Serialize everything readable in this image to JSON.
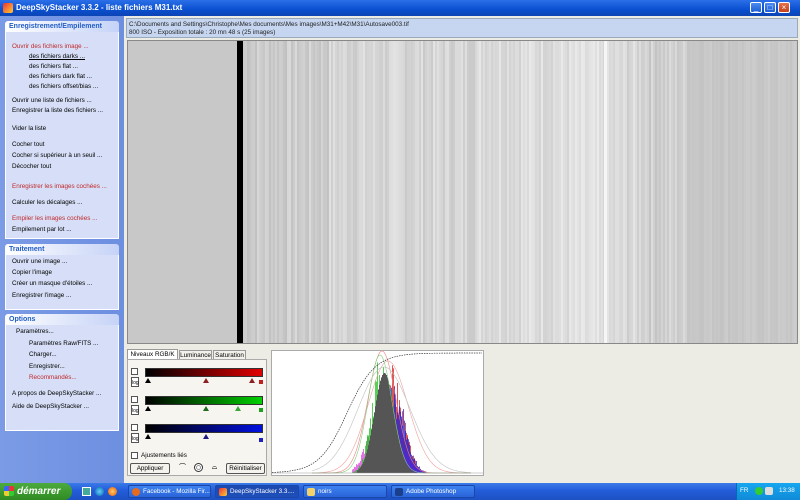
{
  "window": {
    "title": "DeepSkyStacker 3.3.2 - liste fichiers M31.txt"
  },
  "sidebar": {
    "sections": [
      {
        "title": "Enregistrement/Empilement",
        "items": [
          {
            "label": "Ouvrir des fichiers image ...",
            "style": "red",
            "indent": 0
          },
          {
            "label": "des fichiers darks ...",
            "style": "underline",
            "indent": 1
          },
          {
            "label": "des fichiers flat ...",
            "style": "normal",
            "indent": 1
          },
          {
            "label": "des fichiers dark flat ...",
            "style": "normal",
            "indent": 1
          },
          {
            "label": "des fichiers offset/bias ...",
            "style": "normal",
            "indent": 1
          },
          {
            "label": "Ouvrir une liste de fichiers ...",
            "style": "normal",
            "indent": 0
          },
          {
            "label": "Enregistrer la liste des fichiers ...",
            "style": "normal",
            "indent": 0
          },
          {
            "label": "Vider la liste",
            "style": "normal",
            "indent": 0
          },
          {
            "label": "Cocher tout",
            "style": "normal",
            "indent": 0
          },
          {
            "label": "Cocher si supérieur à un seuil ...",
            "style": "normal",
            "indent": 0
          },
          {
            "label": "Décocher tout",
            "style": "normal",
            "indent": 0
          },
          {
            "label": "Enregistrer les images cochées ...",
            "style": "red",
            "indent": 0
          },
          {
            "label": "Calculer les décalages ...",
            "style": "normal",
            "indent": 0
          },
          {
            "label": "Empiler les images cochées ...",
            "style": "red",
            "indent": 0
          },
          {
            "label": "Empilement par lot ...",
            "style": "normal",
            "indent": 0
          }
        ]
      },
      {
        "title": "Traitement",
        "items": [
          {
            "label": "Ouvrir une image ...",
            "style": "normal",
            "indent": 0
          },
          {
            "label": "Copier l'image",
            "style": "normal",
            "indent": 0
          },
          {
            "label": "Créer un masque d'étoiles ...",
            "style": "normal",
            "indent": 0
          },
          {
            "label": "Enregistrer l'image ...",
            "style": "normal",
            "indent": 0
          }
        ]
      },
      {
        "title": "Options",
        "items": [
          {
            "label": "Paramètres...",
            "style": "normal",
            "indent": 1
          },
          {
            "label": "Paramètres Raw/FITS ...",
            "style": "normal",
            "indent": 2
          },
          {
            "label": "Charger...",
            "style": "normal",
            "indent": 2
          },
          {
            "label": "Enregistrer...",
            "style": "normal",
            "indent": 2
          },
          {
            "label": "Recommandés...",
            "style": "red",
            "indent": 2
          },
          {
            "label": "A propos de DeepSkyStacker ...",
            "style": "normal",
            "indent": 0
          },
          {
            "label": "Aide de DeepSkyStacker ...",
            "style": "normal",
            "indent": 0
          }
        ]
      }
    ]
  },
  "info": {
    "path": "C:\\Documents and Settings\\Christophe\\Mes documents\\Mes images\\M31+M42\\M31\\Autosave003.tif",
    "details": "800 ISO - Exposition totale : 20 mn 48 s (25 images)"
  },
  "tabs": [
    {
      "label": "Niveaux RGB/K",
      "active": true
    },
    {
      "label": "Luminance",
      "active": false
    },
    {
      "label": "Saturation",
      "active": false
    }
  ],
  "levels": {
    "log_label": "log",
    "linked_label": "Ajustements liés",
    "apply_label": "Appliquer",
    "reset_label": "Réinitialiser",
    "colors": {
      "red": "#e00000",
      "green": "#00d000",
      "blue": "#0010e0"
    }
  },
  "taskbar": {
    "start_label": "démarrer",
    "tasks": [
      {
        "label": "Facebook - Mozilla Fir...",
        "icon": "firefox-icon",
        "active": false
      },
      {
        "label": "DeepSkyStacker 3.3....",
        "icon": "deepskystacker-icon",
        "active": true
      },
      {
        "label": "noirs",
        "icon": "folder-icon",
        "active": false
      },
      {
        "label": "Adobe Photoshop",
        "icon": "photoshop-icon",
        "active": false
      }
    ],
    "clock": "13:38",
    "lang": "FR"
  }
}
